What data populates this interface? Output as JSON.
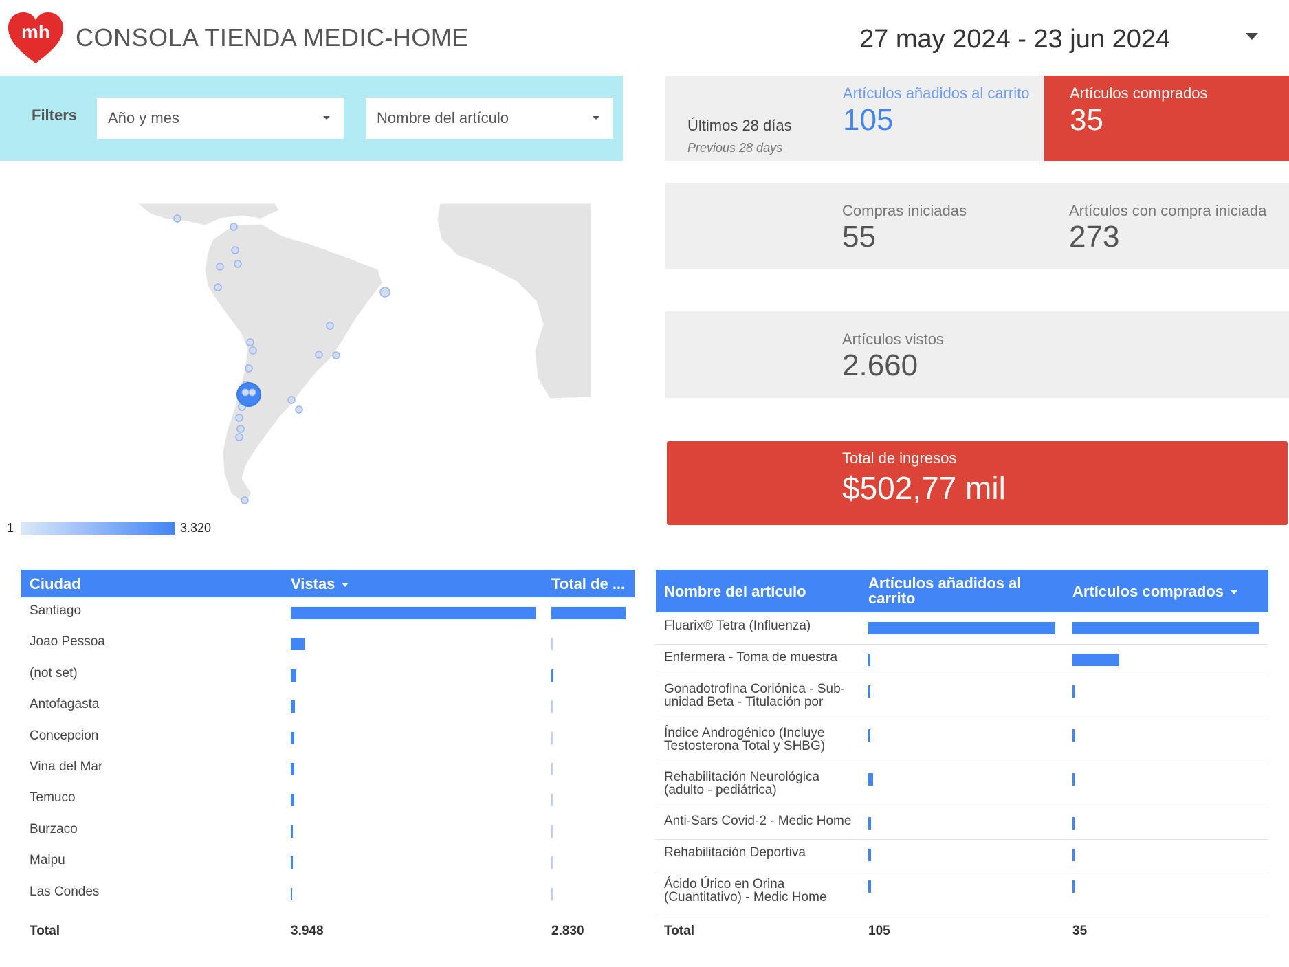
{
  "header": {
    "logo_text": "mh",
    "title": "CONSOLA TIENDA MEDIC-HOME",
    "date_range": "27 may 2024 - 23 jun 2024"
  },
  "filters": {
    "label": "Filters",
    "year_month": "Año y mes",
    "item_name": "Nombre del artículo"
  },
  "comparison": {
    "current": "Últimos 28 días",
    "previous": "Previous 28 days"
  },
  "kpis": {
    "added_to_cart": {
      "label": "Artículos añadidos al carrito",
      "value": "105"
    },
    "purchased": {
      "label": "Artículos comprados",
      "value": "35"
    },
    "checkouts": {
      "label": "Compras iniciadas",
      "value": "55"
    },
    "items_checkout": {
      "label": "Artículos con compra iniciada",
      "value": "273"
    },
    "items_viewed": {
      "label": "Artículos vistos",
      "value": "2.660"
    },
    "revenue": {
      "label": "Total de ingresos",
      "value": "$502,77 mil"
    }
  },
  "map_legend": {
    "min": "1",
    "max": "3.320"
  },
  "city_table": {
    "headers": [
      "Ciudad",
      "Vistas",
      "Total de ..."
    ],
    "rows": [
      {
        "city": "Santiago",
        "views": 1.0,
        "total": 1.0
      },
      {
        "city": "Joao Pessoa",
        "views": 0.055,
        "total": 0.01
      },
      {
        "city": "(not set)",
        "views": 0.022,
        "total": 0.03
      },
      {
        "city": "Antofagasta",
        "views": 0.017,
        "total": 0.01
      },
      {
        "city": "Concepcion",
        "views": 0.014,
        "total": 0.01
      },
      {
        "city": "Vina del Mar",
        "views": 0.014,
        "total": 0.01
      },
      {
        "city": "Temuco",
        "views": 0.013,
        "total": 0.01
      },
      {
        "city": "Burzaco",
        "views": 0.009,
        "total": 0.01
      },
      {
        "city": "Maipu",
        "views": 0.008,
        "total": 0.01
      },
      {
        "city": "Las Condes",
        "views": 0.004,
        "total": 0.01
      }
    ],
    "totals": {
      "label": "Total",
      "views": "3.948",
      "total": "2.830"
    }
  },
  "item_table": {
    "headers": [
      "Nombre del artículo",
      "Artículos añadidos al carrito",
      "Artículos comprados"
    ],
    "rows": [
      {
        "name": "Fluarix® Tetra (Influenza)",
        "added": 1.0,
        "purchased": 1.0
      },
      {
        "name": "Enfermera - Toma de muestra",
        "added": 0.01,
        "purchased": 0.25
      },
      {
        "name": "Gonadotrofina Coriónica - Sub-unidad Beta - Titulación por",
        "added": 0.01,
        "purchased": 0.01
      },
      {
        "name": "Índice Androgénico (Incluye Testosterona Total y SHBG)",
        "added": 0.01,
        "purchased": 0.01
      },
      {
        "name": "Rehabilitación Neurológica (adulto - pediátrica)",
        "added": 0.025,
        "purchased": 0.01
      },
      {
        "name": "Anti-Sars Covid-2 - Medic Home",
        "added": 0.015,
        "purchased": 0.01
      },
      {
        "name": "Rehabilitación Deportiva",
        "added": 0.015,
        "purchased": 0.01
      },
      {
        "name": "Ácido Úrico en Orina (Cuantitativo) - Medic Home",
        "added": 0.015,
        "purchased": 0.01
      }
    ],
    "totals": {
      "label": "Total",
      "added": "105",
      "purchased": "35"
    }
  }
}
